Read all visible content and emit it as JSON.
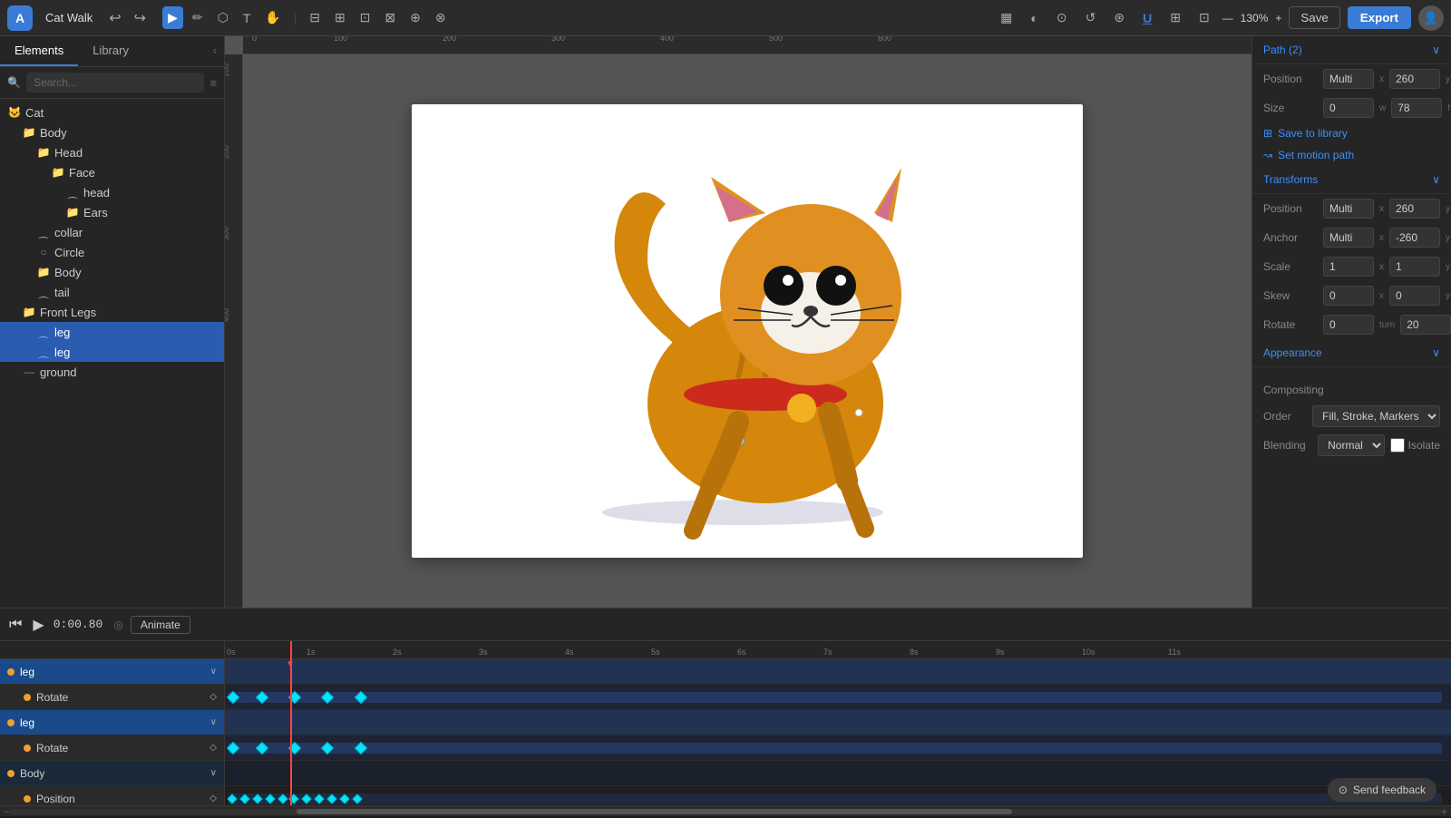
{
  "app": {
    "logo": "A",
    "title": "Cat Walk",
    "save_label": "Save",
    "export_label": "Export",
    "zoom": "130%"
  },
  "tabs": {
    "elements": "Elements",
    "library": "Library"
  },
  "search": {
    "placeholder": "Search..."
  },
  "tree": [
    {
      "id": "cat",
      "label": "Cat",
      "type": "root",
      "indent": 0
    },
    {
      "id": "body-group",
      "label": "Body",
      "type": "folder",
      "indent": 1
    },
    {
      "id": "head-group",
      "label": "Head",
      "type": "folder",
      "indent": 2
    },
    {
      "id": "face-group",
      "label": "Face",
      "type": "folder",
      "indent": 3
    },
    {
      "id": "head-bone",
      "label": "head",
      "type": "bone",
      "indent": 4
    },
    {
      "id": "ears-group",
      "label": "Ears",
      "type": "folder",
      "indent": 4
    },
    {
      "id": "collar-bone",
      "label": "collar",
      "type": "bone",
      "indent": 2
    },
    {
      "id": "circle-shape",
      "label": "Circle",
      "type": "circle",
      "indent": 2
    },
    {
      "id": "body-shape",
      "label": "Body",
      "type": "folder",
      "indent": 2
    },
    {
      "id": "tail-bone",
      "label": "tail",
      "type": "bone",
      "indent": 2
    },
    {
      "id": "front-legs-group",
      "label": "Front Legs",
      "type": "folder",
      "indent": 1
    },
    {
      "id": "leg1",
      "label": "leg",
      "type": "bone-selected",
      "indent": 2
    },
    {
      "id": "leg2",
      "label": "leg",
      "type": "bone-selected",
      "indent": 2
    },
    {
      "id": "ground",
      "label": "ground",
      "type": "line",
      "indent": 1
    }
  ],
  "rightPanel": {
    "path_section": "Path (2)",
    "position_label": "Position",
    "position_value_x": "Multi",
    "position_value_y": "260",
    "size_label": "Size",
    "size_w": "0",
    "size_h": "78",
    "save_to_library": "Save to library",
    "set_motion_path": "Set motion path",
    "transforms_section": "Transforms",
    "anchor_label": "Anchor",
    "anchor_x": "Multi",
    "anchor_y": "-260",
    "scale_label": "Scale",
    "scale_x": "1",
    "scale_y": "1",
    "skew_label": "Skew",
    "skew_x": "0",
    "skew_y": "0",
    "rotate_label": "Rotate",
    "rotate_turn": "0",
    "rotate_deg": "20",
    "appearance_section": "Appearance",
    "compositing_label": "Compositing",
    "order_label": "Order",
    "order_value": "Fill, Stroke, Markers",
    "blending_label": "Blending",
    "blending_value": "Normal",
    "isolate_label": "Isolate"
  },
  "timeline": {
    "time_display": "0:00.80",
    "animate_label": "Animate",
    "time_marks": [
      "0s",
      "1s",
      "2s",
      "3s",
      "4s",
      "5s",
      "6s",
      "7s",
      "8s",
      "9s",
      "10s",
      "11s"
    ],
    "tracks": [
      {
        "label": "leg",
        "type": "header",
        "property": "",
        "has_dropdown": true
      },
      {
        "label": "Rotate",
        "type": "prop",
        "property": "rotate"
      },
      {
        "label": "leg",
        "type": "header2",
        "property": "",
        "has_dropdown": true
      },
      {
        "label": "Rotate",
        "type": "prop",
        "property": "rotate"
      },
      {
        "label": "Body",
        "type": "body",
        "property": "",
        "has_dropdown": true
      },
      {
        "label": "Position",
        "type": "prop2",
        "property": "position"
      }
    ]
  },
  "feedback": {
    "label": "Send feedback"
  }
}
